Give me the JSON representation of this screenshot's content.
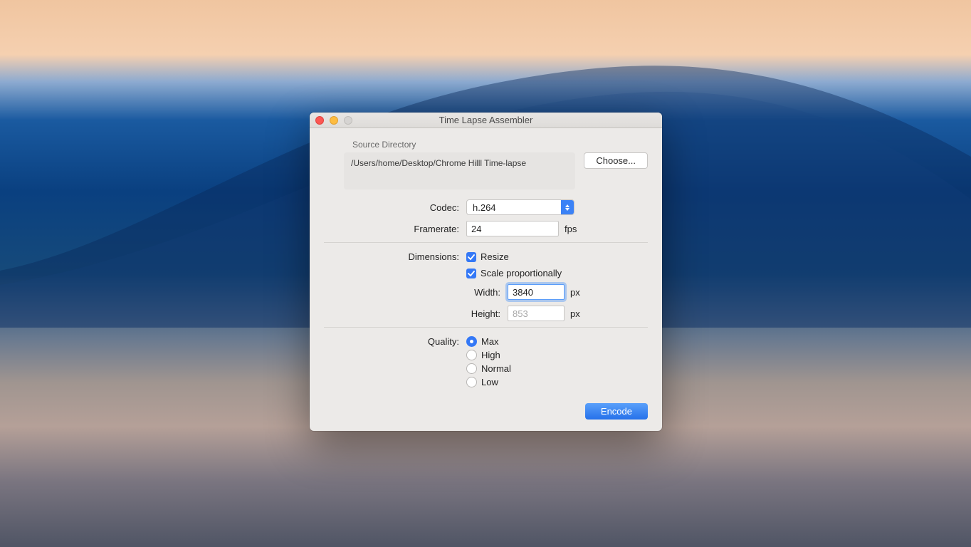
{
  "window": {
    "title": "Time Lapse Assembler"
  },
  "source": {
    "label": "Source Directory",
    "path": "/Users/home/Desktop/Chrome Hilll Time-lapse",
    "choose_label": "Choose..."
  },
  "codec": {
    "label": "Codec:",
    "value": "h.264"
  },
  "framerate": {
    "label": "Framerate:",
    "value": "24",
    "unit": "fps"
  },
  "dimensions": {
    "label": "Dimensions:",
    "resize_label": "Resize",
    "resize_checked": true,
    "scale_label": "Scale proportionally",
    "scale_checked": true,
    "width_label": "Width:",
    "width_value": "3840",
    "width_unit": "px",
    "height_label": "Height:",
    "height_value": "853",
    "height_unit": "px"
  },
  "quality": {
    "label": "Quality:",
    "options": {
      "max": "Max",
      "high": "High",
      "normal": "Normal",
      "low": "Low"
    },
    "selected": "max"
  },
  "footer": {
    "encode_label": "Encode"
  }
}
